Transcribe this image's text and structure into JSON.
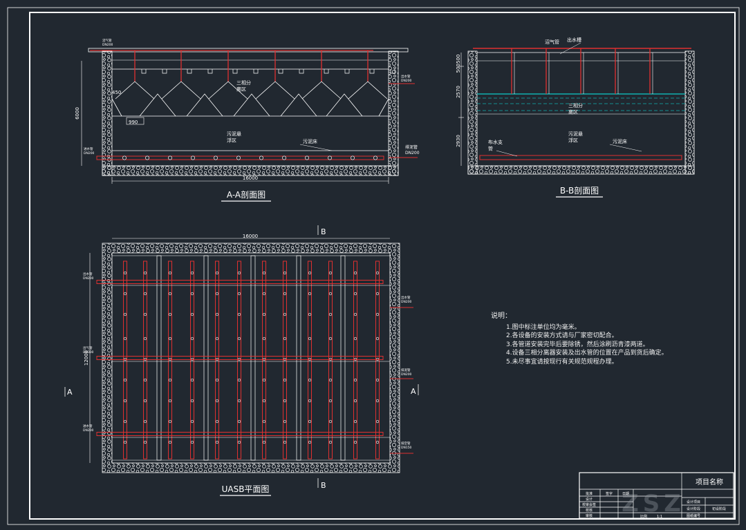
{
  "section_aa": {
    "title": "A-A剖面图",
    "width_dim": "16000",
    "height_dim": "6000",
    "dim_450": "450",
    "dim_990": "990",
    "zone_separator": "三相分\n离区",
    "zone_sludge": "污泥悬\n浮区",
    "sludge_bed": "污泥床",
    "label_biogas": "沼气管\nDN200",
    "label_outlet": "出水管\nDN200",
    "label_inlet": "进水管\nDN200",
    "label_drain": "排泥管\nDN200"
  },
  "section_bb": {
    "title": "B-B剖面图",
    "biogas_pipe": "沼气管",
    "outlet_channel": "出水槽",
    "dim_top": "500500",
    "dim_mid": "2570",
    "dim_bot": "2930",
    "zone_separator": "三相分\n离区",
    "zone_sludge": "污泥悬\n浮区",
    "sludge_bed": "污泥床",
    "water_branch": "布水支\n管"
  },
  "plan": {
    "title": "UASB平面图",
    "width_dim": "16000",
    "height_dim": "12000",
    "section_b_top": "B",
    "section_b_bottom": "B",
    "section_a_left": "A",
    "section_a_right": "A",
    "label_l1": "出水管\nDN200",
    "label_l2": "出气管\nDN300",
    "label_l3": "进水管\nDN200",
    "label_r1": "出水管\nDN200",
    "label_r2": "排泥管\nDN200",
    "label_r3": "排空管\nDN150"
  },
  "notes": {
    "title": "说明：",
    "items": [
      "1.图中标注单位均为毫米。",
      "2.各设备的安装方式请与厂家密切配合。",
      "3.各管道安装完毕后要除锈，然后涂刷沥青漆两道。",
      "4.设备三相分离器安装及出水管的位置在产品到货后确定。",
      "5.未尽事宜请按现行有关规范规程办理。"
    ]
  },
  "title_block": {
    "project_name": "项目名称",
    "col_sign": "签字",
    "col_date": "日期",
    "rows_left": [
      "批准",
      "设计",
      "校审会签",
      "校核",
      "审核"
    ],
    "right_r1": "设计项目",
    "right_r2a": "设计阶段",
    "right_r2b": "初设阶段",
    "right_r3": "图纸编号",
    "scale": "比例",
    "scale_value": "1:1",
    "watermark": "ZSZ"
  },
  "colors": {
    "background": "#212830",
    "line": "#ffffff",
    "pipe": "#e03030",
    "water": "#10b0b0"
  }
}
